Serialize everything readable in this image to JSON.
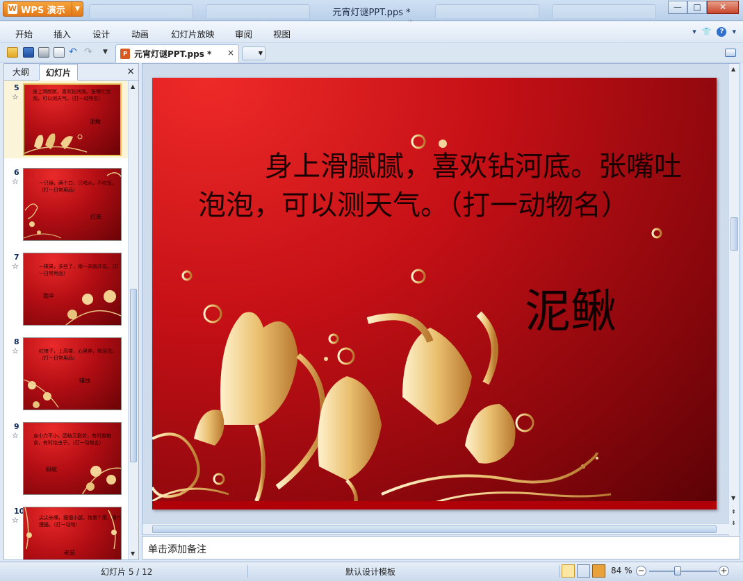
{
  "window": {
    "title": "元宵灯谜PPT.pps *",
    "app_label": "WPS 演示",
    "controls": {
      "minimize": "—",
      "maximize": "□",
      "close": "✕"
    }
  },
  "menu": {
    "items": [
      "开始",
      "插入",
      "设计",
      "动画",
      "幻灯片放映",
      "审阅",
      "视图"
    ],
    "right_icons": [
      "chevron-down-icon",
      "shirt-icon",
      "help-icon"
    ]
  },
  "toolbar": {
    "icons": [
      "open-folder-icon",
      "save-icon",
      "print-icon",
      "print-preview-icon",
      "undo-icon",
      "redo-icon",
      "customize-icon"
    ],
    "document_tab": {
      "label": "元宵灯谜PPT.pps *",
      "close": "×"
    },
    "new_tab": "+"
  },
  "left_panel": {
    "tabs": [
      "大纲",
      "幻灯片"
    ],
    "active_tab": "幻灯片",
    "close": "×",
    "thumbnails": [
      {
        "num": "5",
        "question": "身上滑腻腻，喜欢钻河底。张嘴吐泡泡，可以测天气。（打一动物名）",
        "answer": "泥鳅",
        "selected": true
      },
      {
        "num": "6",
        "question": "一只猴，两个口，只喝水，不吃饭。（打一日常用品）",
        "answer": "灯笼",
        "selected": false
      },
      {
        "num": "7",
        "question": "一棵果，多些了，雨一来就开花。（打一日常用品）",
        "answer": "雨伞",
        "selected": false
      },
      {
        "num": "8",
        "question": "红娘子，上高楼，心里疼，眼泪流。（打一日常用品）",
        "answer": "蜡烛",
        "selected": false
      },
      {
        "num": "9",
        "question": "身小力不小，团结又勤劳，有时搬粮食，有时抬虫子。（打一动物名）",
        "answer": "蚂蚁",
        "selected": false
      },
      {
        "num": "10",
        "question": "尖尖长嘴，细细小腿，拖着个尾，最怕狸猫。（打一动物）",
        "answer": "老鼠",
        "selected": false
      }
    ]
  },
  "slide": {
    "question": "身上滑腻腻，喜欢钻河底。张嘴吐泡泡，可以测天气。（打一动物名）",
    "answer": "泥鳅"
  },
  "notes": {
    "placeholder": "单击添加备注"
  },
  "status": {
    "page": "幻灯片 5 / 12",
    "template": "默认设计模板",
    "zoom": "84 %",
    "zoom_percent": 84,
    "zoom_minus": "−",
    "zoom_plus": "+"
  },
  "colors": {
    "accent": "#e2781a",
    "slide_red": "#c41016",
    "chrome_blue": "#dbe6f3"
  }
}
